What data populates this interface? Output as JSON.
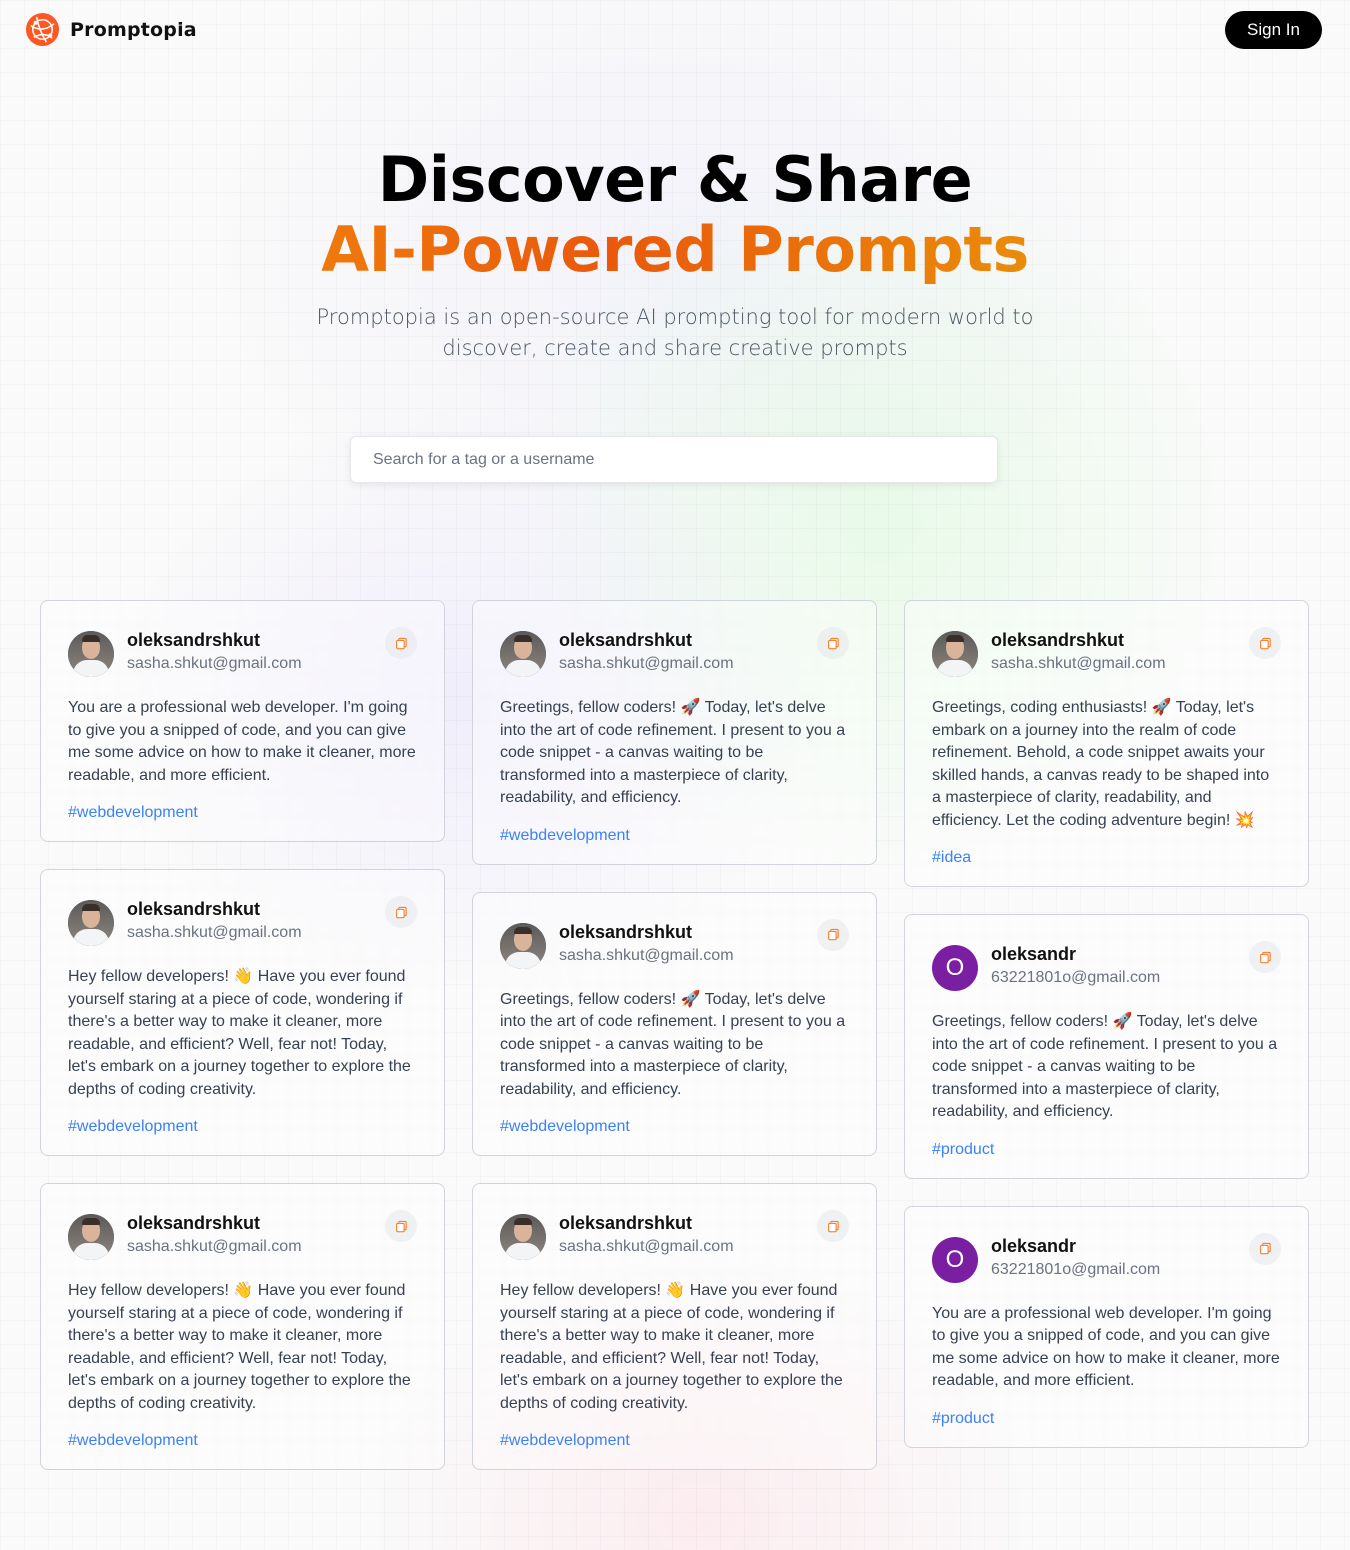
{
  "brand": {
    "name": "Promptopia",
    "accent": "#ff5722"
  },
  "nav": {
    "signin_label": "Sign In"
  },
  "hero": {
    "title_line1": "Discover & Share",
    "title_line2": "AI-Powered Prompts",
    "description": "Promptopia is an open-source AI prompting tool for modern world to discover, create and share creative prompts"
  },
  "search": {
    "placeholder": "Search for a tag or a username",
    "value": ""
  },
  "columns": [
    [
      {
        "avatar": "photo",
        "username": "oleksandrshkut",
        "email": "sasha.shkut@gmail.com",
        "prompt": "You are a professional web developer. I'm going to give you a snipped of code, and you can give me some advice on how to make it cleaner, more readable, and more efficient.",
        "tag": "#webdevelopment"
      },
      {
        "avatar": "photo",
        "username": "oleksandrshkut",
        "email": "sasha.shkut@gmail.com",
        "prompt": "Hey fellow developers! 👋 Have you ever found yourself staring at a piece of code, wondering if there's a better way to make it cleaner, more readable, and efficient? Well, fear not! Today, let's embark on a journey together to explore the depths of coding creativity.",
        "tag": "#webdevelopment"
      },
      {
        "avatar": "photo",
        "username": "oleksandrshkut",
        "email": "sasha.shkut@gmail.com",
        "prompt": "Hey fellow developers! 👋 Have you ever found yourself staring at a piece of code, wondering if there's a better way to make it cleaner, more readable, and efficient? Well, fear not! Today, let's embark on a journey together to explore the depths of coding creativity.",
        "tag": "#webdevelopment"
      }
    ],
    [
      {
        "avatar": "photo",
        "username": "oleksandrshkut",
        "email": "sasha.shkut@gmail.com",
        "prompt": "Greetings, fellow coders! 🚀 Today, let's delve into the art of code refinement. I present to you a code snippet - a canvas waiting to be transformed into a masterpiece of clarity, readability, and efficiency.",
        "tag": "#webdevelopment"
      },
      {
        "avatar": "photo",
        "username": "oleksandrshkut",
        "email": "sasha.shkut@gmail.com",
        "prompt": "Greetings, fellow coders! 🚀 Today, let's delve into the art of code refinement. I present to you a code snippet - a canvas waiting to be transformed into a masterpiece of clarity, readability, and efficiency.",
        "tag": "#webdevelopment"
      },
      {
        "avatar": "photo",
        "username": "oleksandrshkut",
        "email": "sasha.shkut@gmail.com",
        "prompt": "Hey fellow developers! 👋 Have you ever found yourself staring at a piece of code, wondering if there's a better way to make it cleaner, more readable, and efficient? Well, fear not! Today, let's embark on a journey together to explore the depths of coding creativity.",
        "tag": "#webdevelopment"
      }
    ],
    [
      {
        "avatar": "photo",
        "username": "oleksandrshkut",
        "email": "sasha.shkut@gmail.com",
        "prompt": "Greetings, coding enthusiasts! 🚀 Today, let's embark on a journey into the realm of code refinement. Behold, a code snippet awaits your skilled hands, a canvas ready to be shaped into a masterpiece of clarity, readability, and efficiency. Let the coding adventure begin! 💥",
        "tag": "#idea"
      },
      {
        "avatar": "letter",
        "avatar_letter": "O",
        "avatar_color": "#7b1fa2",
        "username": "oleksandr",
        "email": "63221801o@gmail.com",
        "prompt": "Greetings, fellow coders! 🚀 Today, let's delve into the art of code refinement. I present to you a code snippet - a canvas waiting to be transformed into a masterpiece of clarity, readability, and efficiency.",
        "tag": "#product"
      },
      {
        "avatar": "letter",
        "avatar_letter": "O",
        "avatar_color": "#7b1fa2",
        "username": "oleksandr",
        "email": "63221801o@gmail.com",
        "prompt": "You are a professional web developer. I'm going to give you a snipped of code, and you can give me some advice on how to make it cleaner, more readable, and more efficient.",
        "tag": "#product"
      }
    ]
  ]
}
